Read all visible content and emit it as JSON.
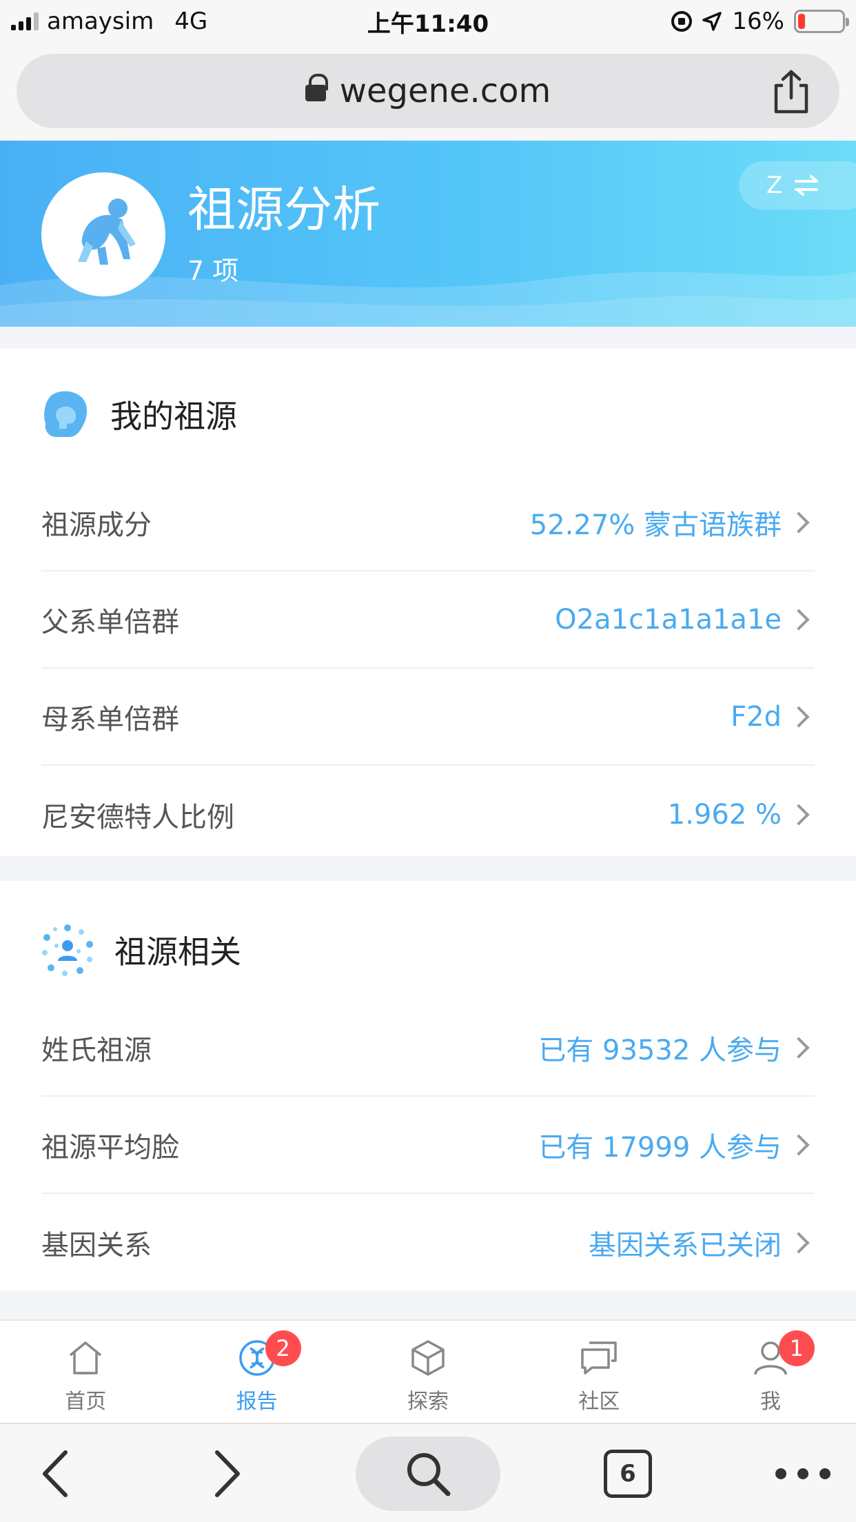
{
  "status_bar": {
    "carrier": "amaysim",
    "network": "4G",
    "time": "上午11:40",
    "battery_text": "16%",
    "battery_level": 0.16
  },
  "address_bar": {
    "url": "wegene.com"
  },
  "header": {
    "title": "祖源分析",
    "subtitle": "7 项",
    "lang_toggle_label": "Z"
  },
  "section_my_ancestry": {
    "title": "我的祖源",
    "rows": [
      {
        "label": "祖源成分",
        "value": "52.27% 蒙古语族群"
      },
      {
        "label": "父系单倍群",
        "value": "O2a1c1a1a1a1e"
      },
      {
        "label": "母系单倍群",
        "value": "F2d"
      },
      {
        "label": "尼安德特人比例",
        "value": "1.962 %"
      }
    ]
  },
  "section_related": {
    "title": "祖源相关",
    "rows": [
      {
        "label": "姓氏祖源",
        "value": "已有 93532 人参与"
      },
      {
        "label": "祖源平均脸",
        "value": "已有 17999 人参与"
      },
      {
        "label": "基因关系",
        "value": "基因关系已关闭"
      }
    ]
  },
  "tab_bar": {
    "tabs": [
      {
        "label": "首页",
        "icon": "home-icon"
      },
      {
        "label": "报告",
        "icon": "dna-report-icon",
        "badge": "2",
        "active": true
      },
      {
        "label": "探索",
        "icon": "cube-icon"
      },
      {
        "label": "社区",
        "icon": "chat-icon"
      },
      {
        "label": "我",
        "icon": "user-icon",
        "badge": "1"
      }
    ]
  },
  "browser_toolbar": {
    "tabs_count": "6"
  },
  "colors": {
    "accent": "#4aaaf0",
    "banner_start": "#4ab0f5",
    "banner_end": "#6cdcf8",
    "badge": "#ff4d4f"
  }
}
